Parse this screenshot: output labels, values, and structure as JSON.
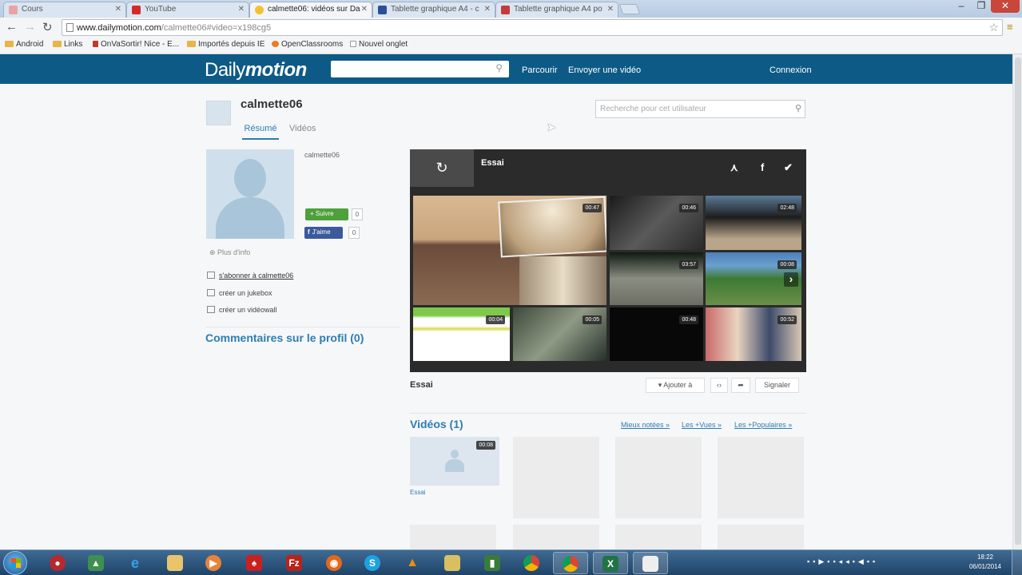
{
  "browser": {
    "tabs": [
      {
        "label": "Cours"
      },
      {
        "label": "YouTube"
      },
      {
        "label": "calmette06: vidéos sur Da"
      },
      {
        "label": "Tablette graphique A4 - c"
      },
      {
        "label": "Tablette graphique A4 po"
      }
    ],
    "url_host": "www.dailymotion.com",
    "url_path": "/calmette06#video=x198cg5",
    "bookmarks": [
      "Android",
      "Links",
      "OnVaSortir! Nice - E...",
      "Importés depuis IE",
      "OpenClassrooms",
      "Nouvel onglet"
    ]
  },
  "dm": {
    "logo_regular": "Daily",
    "logo_bold": "motion",
    "nav": {
      "browse": "Parcourir",
      "upload": "Envoyer une vidéo",
      "login": "Connexion"
    }
  },
  "profile": {
    "username": "calmette06",
    "tabs": {
      "summary": "Résumé",
      "videos": "Vidéos"
    },
    "user_search_placeholder": "Recherche pour cet utilisateur",
    "name_small": "calmette06",
    "follow_label": "+ Suivre",
    "follow_count": "0",
    "like_label": "J'aime",
    "like_count": "0",
    "more_info": "Plus d'info",
    "links": {
      "subscribe": "s'abonner à calmette06",
      "jukebox": "créer un jukebox",
      "videowall": "créer un vidéowall"
    },
    "comments_title": "Commentaires sur le profil (0)"
  },
  "player": {
    "title": "Essai",
    "replay_icon": "replay-icon",
    "share_icons": [
      "network-icon",
      "facebook-icon",
      "twitter-icon"
    ],
    "durations": [
      "00:47",
      "00:46",
      "02:48",
      "03:57",
      "00:08",
      "00:04",
      "00:05",
      "00:48",
      "00:52"
    ]
  },
  "video": {
    "title": "Essai",
    "add_to": "Ajouter à",
    "report": "Signaler"
  },
  "videos_section": {
    "title": "Vidéos (1)",
    "filters": [
      "Mieux notées »",
      "Les +Vues »",
      "Les +Populaires »"
    ],
    "first_duration": "00:08",
    "first_title": "Essai"
  },
  "taskbar": {
    "clock_time": "18:22",
    "clock_date": "06/01/2014"
  },
  "colors": {
    "brand": "#0d5a86",
    "link": "#2d7db3",
    "follow": "#4ea13a",
    "facebook": "#3b5a9b"
  }
}
